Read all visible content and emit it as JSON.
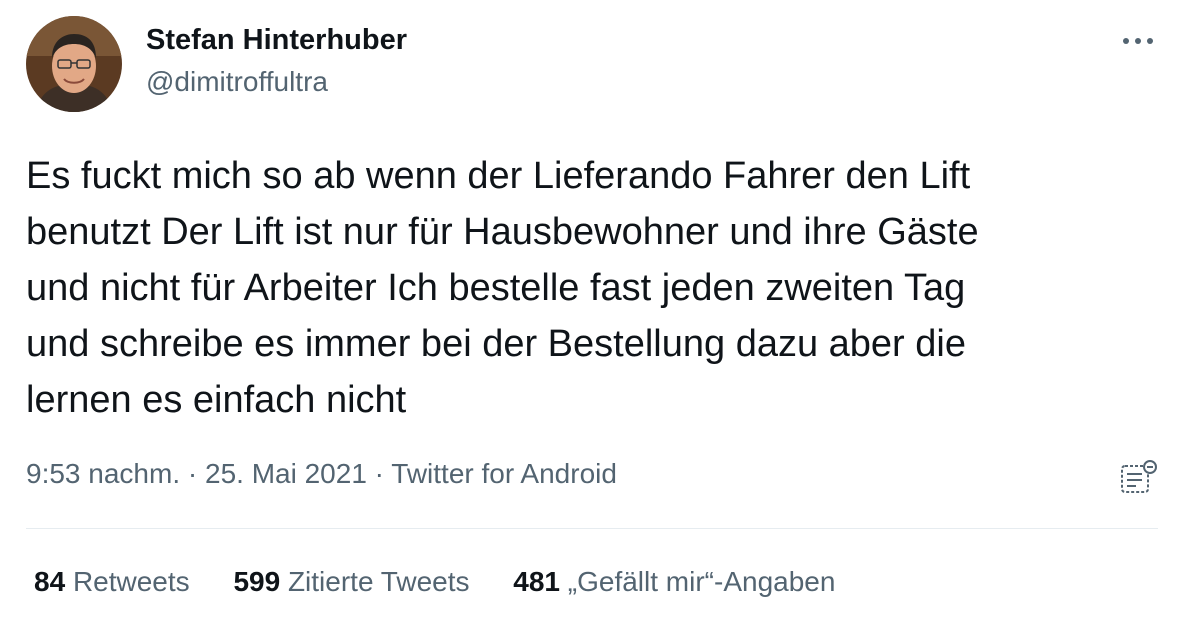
{
  "user": {
    "display_name": "Stefan Hinterhuber",
    "handle": "@dimitroffultra"
  },
  "tweet": {
    "text": "Es fuckt mich so ab wenn der Lieferando Fahrer den Lift\nbenutzt Der Lift ist nur für Hausbewohner und ihre Gäste\nund nicht für Arbeiter Ich bestelle fast jeden zweiten Tag\nund schreibe es immer bei der Bestellung dazu aber die\nlernen es einfach nicht",
    "time": "9:53 nachm.",
    "separator": "·",
    "date": "25. Mai 2021",
    "source": "Twitter for Android"
  },
  "stats": {
    "retweets": {
      "count": "84",
      "label": "Retweets"
    },
    "quotes": {
      "count": "599",
      "label": "Zitierte Tweets"
    },
    "likes": {
      "count": "481",
      "label": "„Gefällt mir“-Angaben"
    }
  },
  "icons": {
    "more": "more-horizontal-icon",
    "analytics": "analytics-icon"
  },
  "colors": {
    "text_primary": "#0f1419",
    "text_secondary": "#536471",
    "divider": "#e6ecf0"
  }
}
